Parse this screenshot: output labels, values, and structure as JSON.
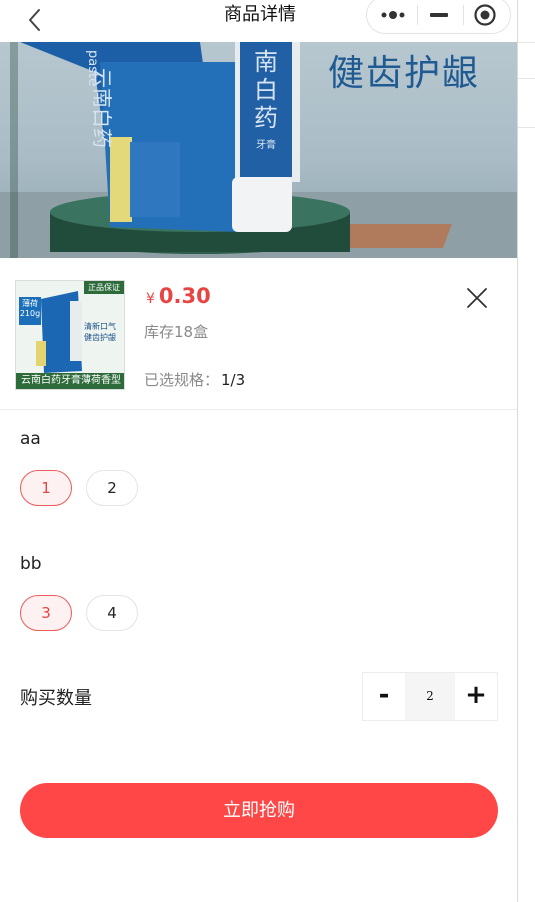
{
  "nav": {
    "title": "商品详情",
    "back_icon": "chevron-left-icon",
    "more_icon": "more-dots-icon",
    "minimize_icon": "minus-icon",
    "close_icon": "target-circle-icon"
  },
  "banner": {
    "slogan": "健齿护龈",
    "pack_brand": "云南白药",
    "tube_brand": "南白药",
    "tube_sub": "牙膏",
    "pack_en": "paste"
  },
  "product": {
    "thumb_badge": "正品保证",
    "thumb_side": "薄荷 210g",
    "thumb_promo_1": "清新口气",
    "thumb_promo_2": "健齿护龈",
    "thumb_caption": "云南白药牙膏薄荷香型",
    "currency": "¥",
    "price": "0.30",
    "stock": "库存18盒",
    "selected_label": "已选规格：",
    "selected_value": "1/3"
  },
  "specs": [
    {
      "title": "aa",
      "options": [
        "1",
        "2"
      ],
      "selected": "1"
    },
    {
      "title": "bb",
      "options": [
        "3",
        "4"
      ],
      "selected": "3"
    }
  ],
  "quantity": {
    "label": "购买数量",
    "minus": "-",
    "value": "2",
    "plus": "+"
  },
  "buy_button": "立即抢购",
  "colors": {
    "accent": "#ff4747",
    "price": "#e94444",
    "chip_active_border": "#ee5b5b",
    "chip_active_bg": "#fdf1f1"
  }
}
